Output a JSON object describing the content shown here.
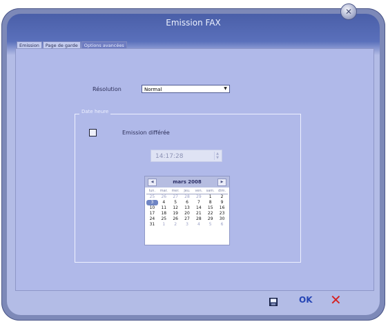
{
  "window": {
    "title": "Emission FAX"
  },
  "tabs": [
    {
      "label": "Emission"
    },
    {
      "label": "Page de garde"
    },
    {
      "label": "Options avancées"
    }
  ],
  "resolution": {
    "label": "Résolution",
    "value": "Normal"
  },
  "group": {
    "legend": "Date heure"
  },
  "deferred": {
    "label": "Emission différée",
    "checked": false
  },
  "time": {
    "value": "14:17:28"
  },
  "calendar": {
    "month": "mars 2008",
    "days_of_week": [
      "lun.",
      "mar.",
      "mer.",
      "jeu.",
      "ven.",
      "sam.",
      "dim."
    ],
    "rows": [
      [
        "25",
        "26",
        "27",
        "28",
        "29",
        "1",
        "2"
      ],
      [
        "3",
        "4",
        "5",
        "6",
        "7",
        "8",
        "9"
      ],
      [
        "10",
        "11",
        "12",
        "13",
        "14",
        "15",
        "16"
      ],
      [
        "17",
        "18",
        "19",
        "20",
        "21",
        "22",
        "23"
      ],
      [
        "24",
        "25",
        "26",
        "27",
        "28",
        "29",
        "30"
      ],
      [
        "31",
        "1",
        "2",
        "3",
        "4",
        "5",
        "6"
      ]
    ],
    "today": "3"
  },
  "footer": {
    "ok_label": "OK",
    "cancel_symbol": "✕"
  }
}
